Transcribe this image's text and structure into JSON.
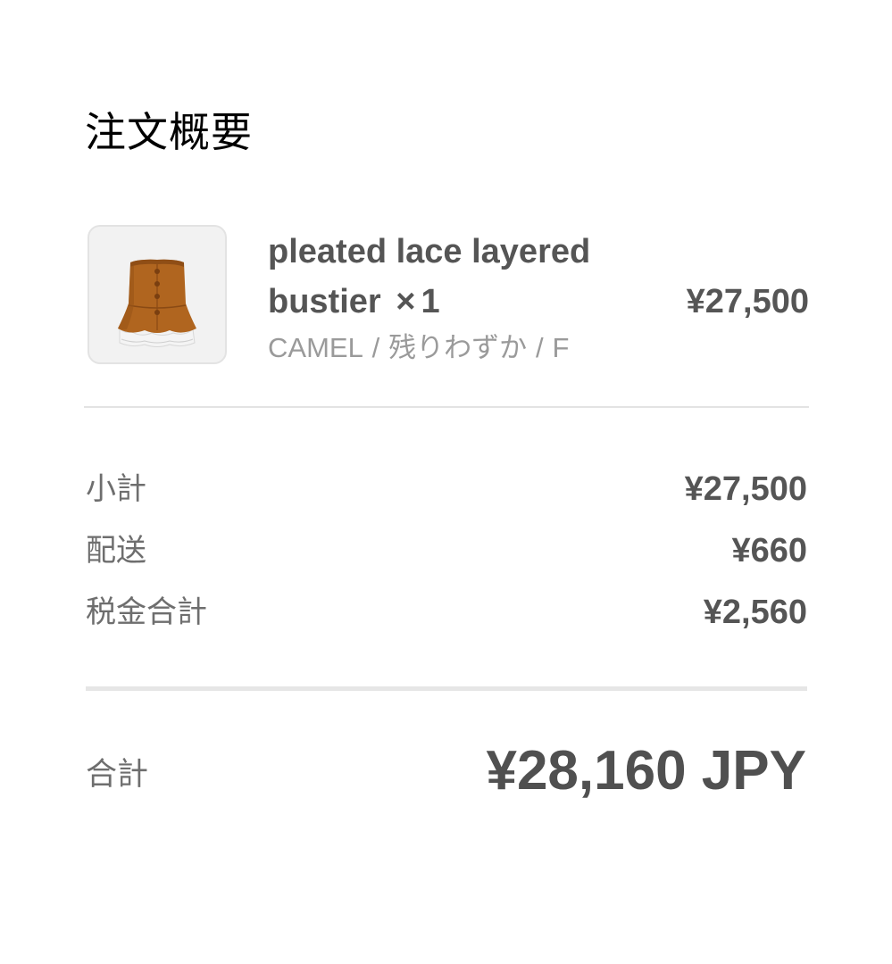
{
  "summary": {
    "title": "注文概要"
  },
  "product": {
    "name": "pleated lace layered bustier",
    "qty_separator": "×",
    "quantity": "1",
    "variant_color": "CAMEL",
    "variant_stock": "残りわずか",
    "variant_size": "F",
    "variant_separator": "/",
    "price": "¥27,500",
    "image_icon": "bustier-image",
    "garment_color": "#b0651f"
  },
  "lines": {
    "subtotal_label": "小計",
    "subtotal_value": "¥27,500",
    "shipping_label": "配送",
    "shipping_value": "¥660",
    "tax_label": "税金合計",
    "tax_value": "¥2,560"
  },
  "total": {
    "label": "合計",
    "value": "¥28,160 JPY"
  }
}
